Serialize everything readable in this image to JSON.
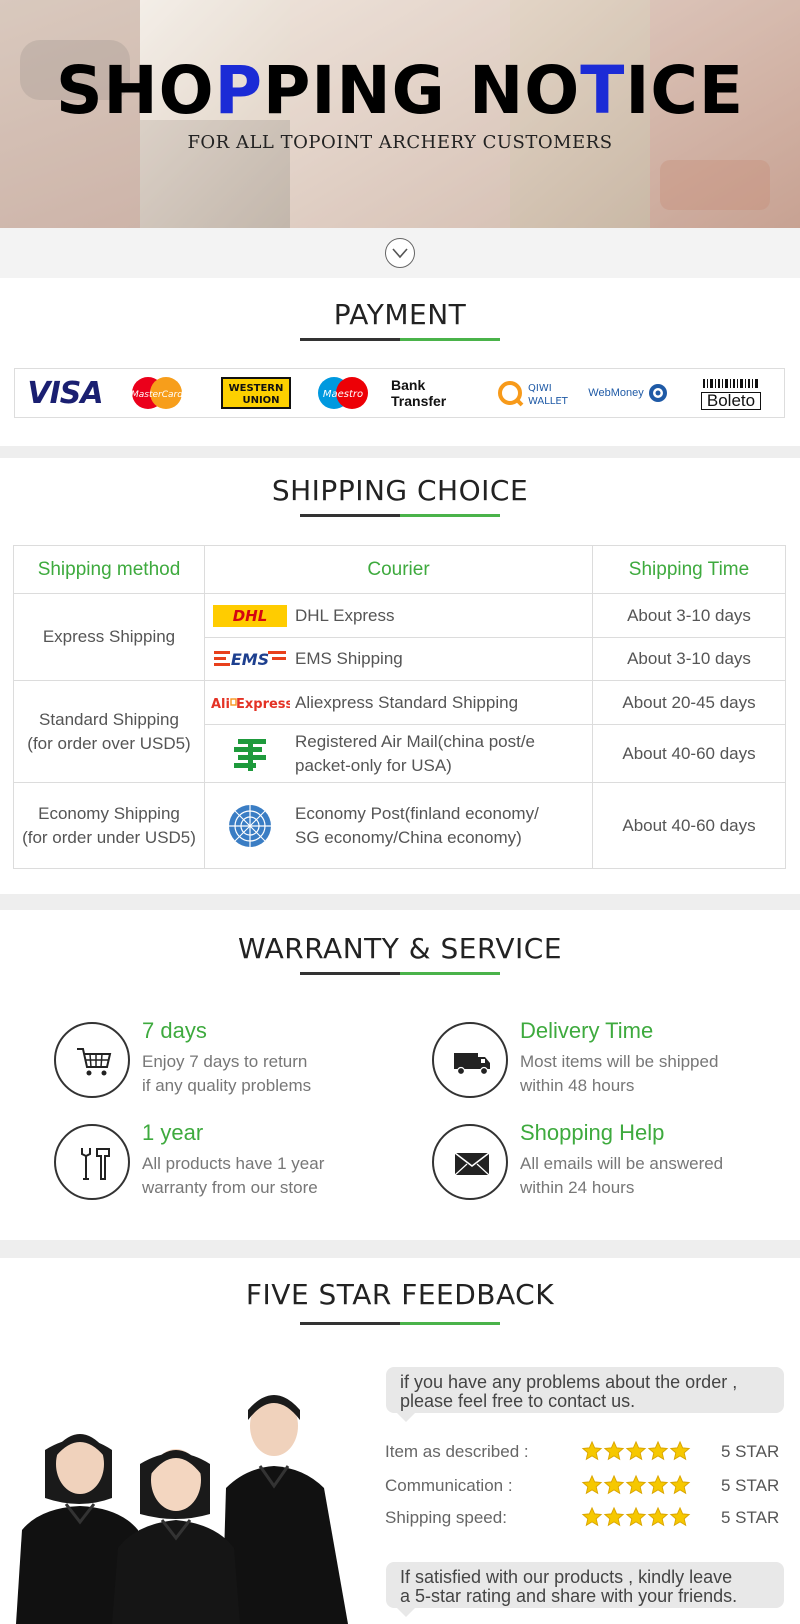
{
  "banner": {
    "title_a": "SHO",
    "title_hl1": "P",
    "title_b": "PING  NO",
    "title_hl2": "T",
    "title_c": "ICE",
    "subtitle": "FOR ALL TOPOINT ARCHERY CUSTOMERS"
  },
  "payment": {
    "title": "PAYMENT",
    "methods": [
      "VISA",
      "MasterCard",
      "WESTERN UNION",
      "Maestro",
      "Bank Transfer",
      "QIWI WALLET",
      "WebMoney",
      "Boleto"
    ]
  },
  "shipping": {
    "title": "SHIPPING CHOICE",
    "headers": [
      "Shipping method",
      "Courier",
      "Shipping Time"
    ],
    "groups": [
      {
        "method": "Express Shipping",
        "method_note": "",
        "rows": [
          {
            "icon": "dhl-logo",
            "courier": "DHL Express",
            "time": "About 3-10 days"
          },
          {
            "icon": "ems-logo",
            "courier": "EMS Shipping",
            "time": "About 3-10 days"
          }
        ]
      },
      {
        "method": "Standard Shipping",
        "method_note": "(for order over USD5)",
        "rows": [
          {
            "icon": "aliexpress-logo",
            "courier": "Aliexpress Standard Shipping",
            "time": "About 20-45 days"
          },
          {
            "icon": "china-post-logo",
            "courier": "Registered Air Mail(china post/e",
            "courier_line2": "packet-only for USA)",
            "time": "About 40-60 days"
          }
        ]
      },
      {
        "method": "Economy Shipping",
        "method_note": "(for order under USD5)",
        "rows": [
          {
            "icon": "un-globe-logo",
            "courier": "Economy Post(finland economy/",
            "courier_line2": "SG economy/China economy)",
            "time": "About 40-60 days"
          }
        ]
      }
    ]
  },
  "warranty": {
    "title": "WARRANTY & SERVICE",
    "items": [
      {
        "icon": "cart-icon",
        "head": "7 days",
        "line1": "Enjoy 7 days to return",
        "line2": "if any quality problems"
      },
      {
        "icon": "truck-icon",
        "head": "Delivery Time",
        "line1": "Most items will be shipped",
        "line2": "within 48 hours"
      },
      {
        "icon": "tools-icon",
        "head": "1 year",
        "line1": "All products have 1 year",
        "line2": "warranty from our store"
      },
      {
        "icon": "envelope-icon",
        "head": "Shopping Help",
        "line1": "All emails will be answered",
        "line2": "within 24 hours"
      }
    ]
  },
  "feedback": {
    "title": "FIVE STAR FEEDBACK",
    "bubble_top_1": "if you have any problems about the order ,",
    "bubble_top_2": "please feel free to contact us.",
    "ratings": [
      {
        "label": "Item as described :",
        "stars": 5,
        "value": "5 STAR"
      },
      {
        "label": "Communication :",
        "stars": 5,
        "value": "5 STAR"
      },
      {
        "label": "Shipping speed:",
        "stars": 5,
        "value": "5 STAR"
      }
    ],
    "bubble_bottom_1": "If satisfied with our products , kindly leave",
    "bubble_bottom_2": "a 5-star rating and share with your friends."
  },
  "colors": {
    "accent_green": "#3eaa3e",
    "title_blue": "#1b2bd6",
    "rule_dark": "#333333"
  }
}
